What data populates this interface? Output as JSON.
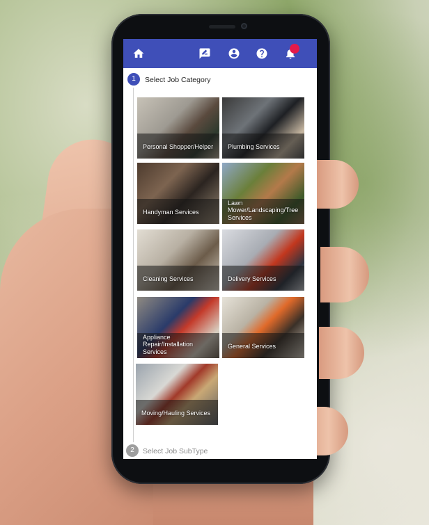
{
  "header": {
    "icons": [
      "home-icon",
      "chat-icon",
      "account-icon",
      "help-icon",
      "bell-icon"
    ],
    "accent_color": "#3f4fb8",
    "notification_color": "#e5194a"
  },
  "steps": [
    {
      "number": "1",
      "label": "Select Job Category",
      "active": true
    },
    {
      "number": "2",
      "label": "Select Job SubType",
      "active": false
    }
  ],
  "categories": [
    {
      "label": "Personal Shopper/Helper"
    },
    {
      "label": "Plumbing Services"
    },
    {
      "label": "Handyman Services"
    },
    {
      "label": "Lawn Mower/Landscaping/Tree Services"
    },
    {
      "label": "Cleaning Services"
    },
    {
      "label": "Delivery Services"
    },
    {
      "label": "Appliance Repair/Installation Services"
    },
    {
      "label": "General Services"
    },
    {
      "label": "Moving/Hauling Services"
    }
  ]
}
